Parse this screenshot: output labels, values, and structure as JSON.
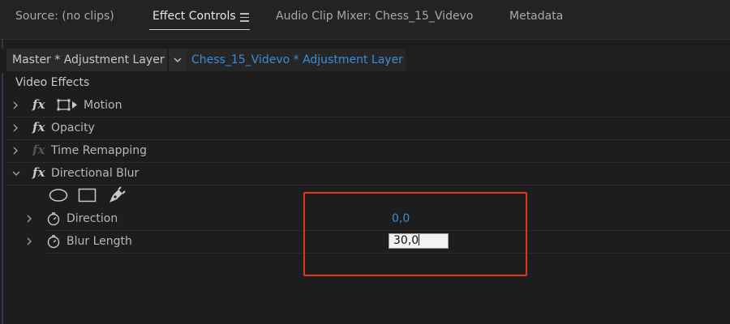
{
  "tabs": {
    "source": "Source: (no clips)",
    "effect_controls": "Effect Controls",
    "audio_clip_mixer": "Audio Clip Mixer: Chess_15_Videvo",
    "metadata": "Metadata"
  },
  "breadcrumb": {
    "master": "Master * Adjustment Layer",
    "clip": "Chess_15_Videvo * Adjustment Layer"
  },
  "section_header": "Video Effects",
  "effects": [
    {
      "label": "Motion"
    },
    {
      "label": "Opacity"
    },
    {
      "label": "Time Remapping"
    },
    {
      "label": "Directional Blur"
    }
  ],
  "params": [
    {
      "label": "Direction",
      "value": "0,0"
    },
    {
      "label": "Blur Length",
      "value": "30,0"
    }
  ],
  "colors": {
    "accent_blue": "#3a8ed8",
    "highlight_red": "#e8321f"
  }
}
